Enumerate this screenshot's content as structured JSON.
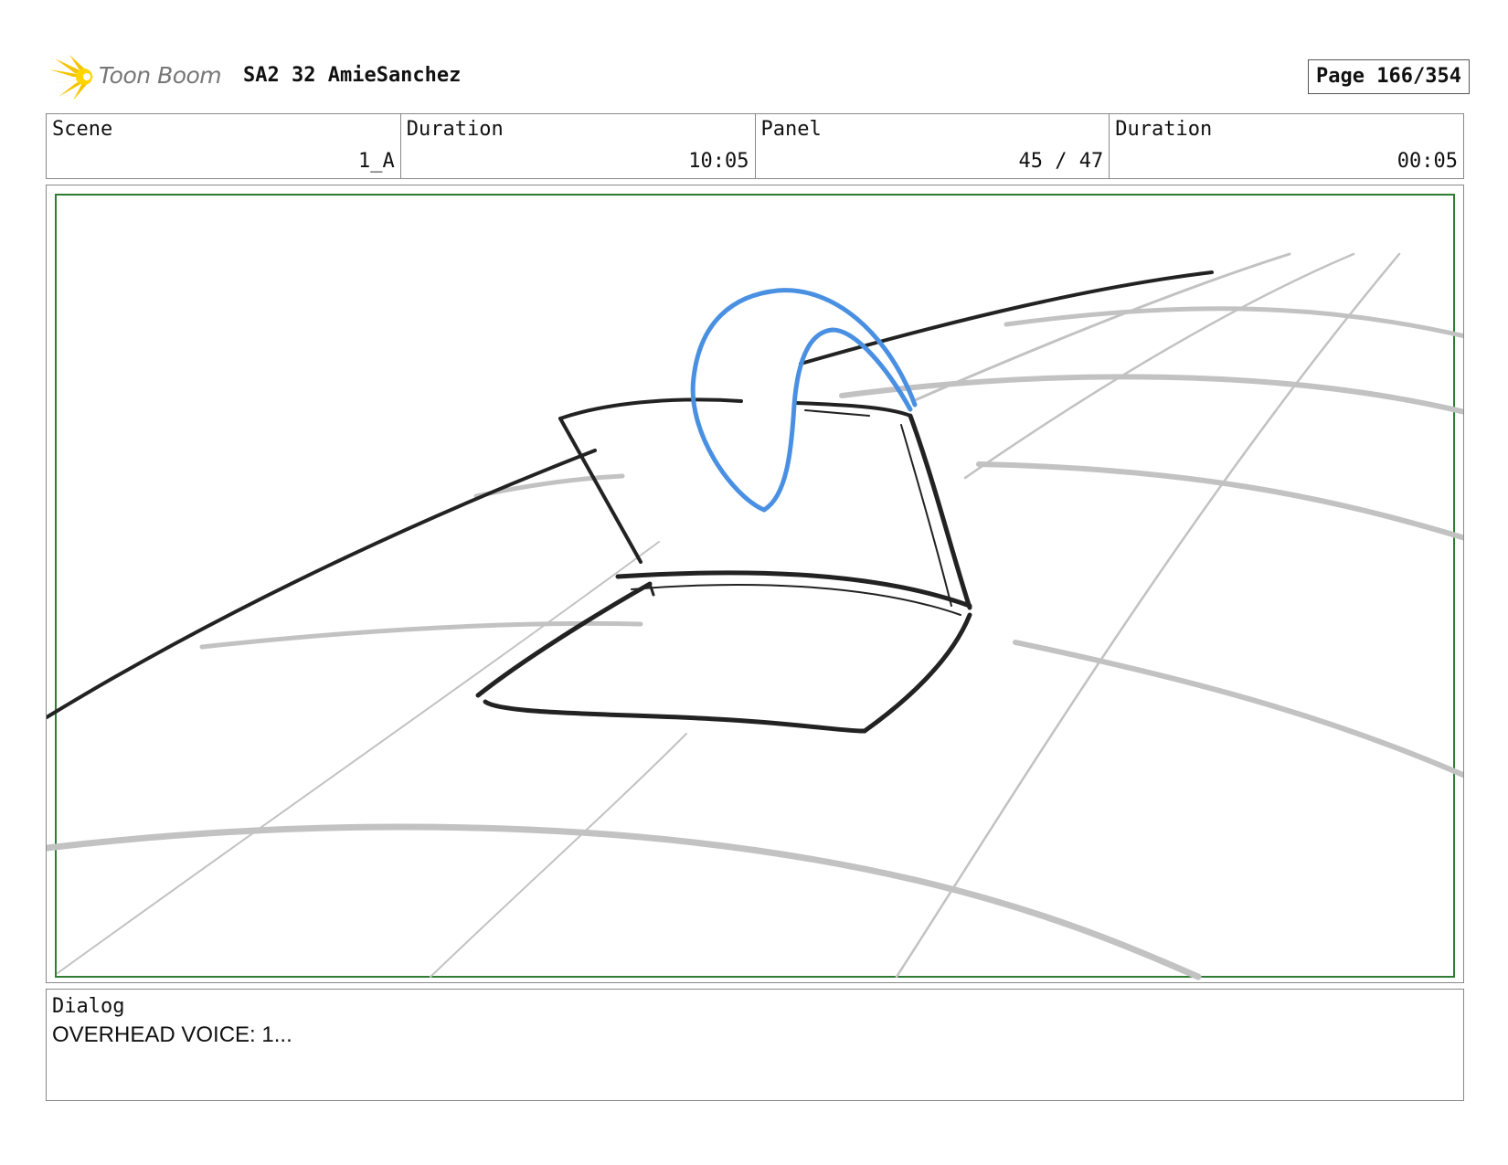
{
  "header": {
    "logo_text": "Toon Boom",
    "title": "SA2 32 AmieSanchez",
    "page": "Page 166/354"
  },
  "info": {
    "scene_label": "Scene",
    "scene_value": "1_A",
    "duration_label": "Duration",
    "duration_value": "10:05",
    "panel_label": "Panel",
    "panel_value": "45 / 47",
    "panel_duration_label": "Duration",
    "panel_duration_value": "00:05"
  },
  "dialog": {
    "label": "Dialog",
    "text": "OVERHEAD VOICE: 1..."
  },
  "colors": {
    "logo_accent": "#f5c400",
    "sketch_ink": "#222222",
    "grid_line": "#bdbdbd",
    "ribbon": "#4a90e2",
    "safe_frame": "#2e7d32"
  }
}
